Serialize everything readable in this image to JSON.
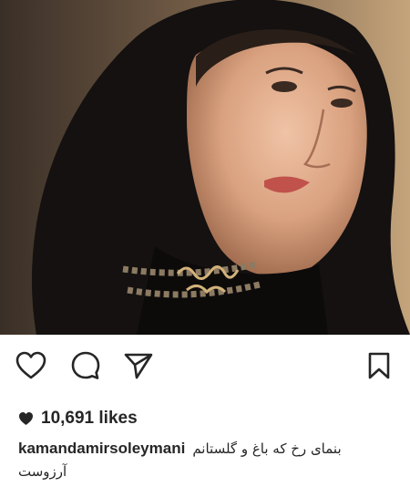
{
  "post": {
    "photo": {
      "icon": "portrait-photo",
      "pendant_icon": "calligraphy-pendant"
    },
    "actions": {
      "like_icon": "heart-outline-icon",
      "comment_icon": "comment-icon",
      "share_icon": "share-icon",
      "save_icon": "bookmark-icon"
    },
    "likes": {
      "count": "10,691 likes"
    },
    "caption": {
      "username": "kamandamirsoleymani",
      "text_line1": "بنمای رخ که باغ و گلستانم",
      "text_line2": "آرزوست"
    }
  },
  "colors": {
    "text": "#262626",
    "background": "#ffffff",
    "icon_stroke": "#262626"
  }
}
